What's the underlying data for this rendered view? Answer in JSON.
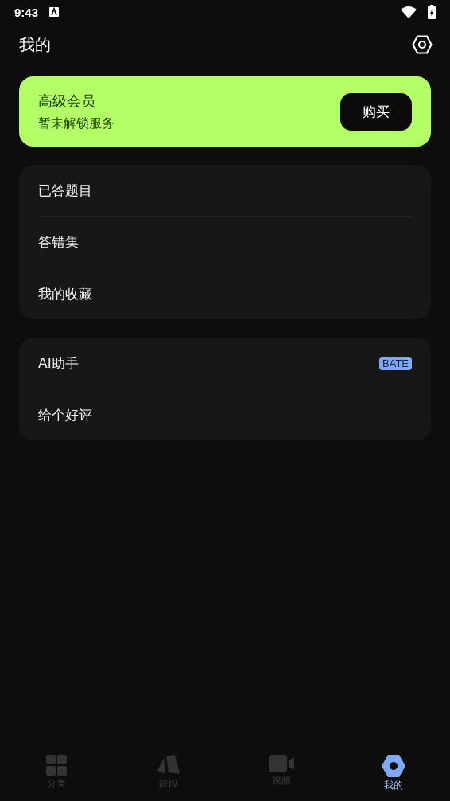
{
  "status_bar": {
    "time": "9:43"
  },
  "header": {
    "title": "我的"
  },
  "premium": {
    "title": "高级会员",
    "subtitle": "暂未解锁服务",
    "button": "购买"
  },
  "groups": [
    {
      "items": [
        {
          "label": "已答题目"
        },
        {
          "label": "答错集"
        },
        {
          "label": "我的收藏"
        }
      ]
    },
    {
      "items": [
        {
          "label": "AI助手",
          "badge": "BATE"
        },
        {
          "label": "给个好评"
        }
      ]
    }
  ],
  "nav": [
    {
      "kind": "grid",
      "label": "分类",
      "selected": false
    },
    {
      "kind": "stage",
      "label": "阶段",
      "selected": false
    },
    {
      "kind": "video",
      "label": "视频",
      "selected": false
    },
    {
      "kind": "nut",
      "label": "我的",
      "selected": true
    }
  ]
}
